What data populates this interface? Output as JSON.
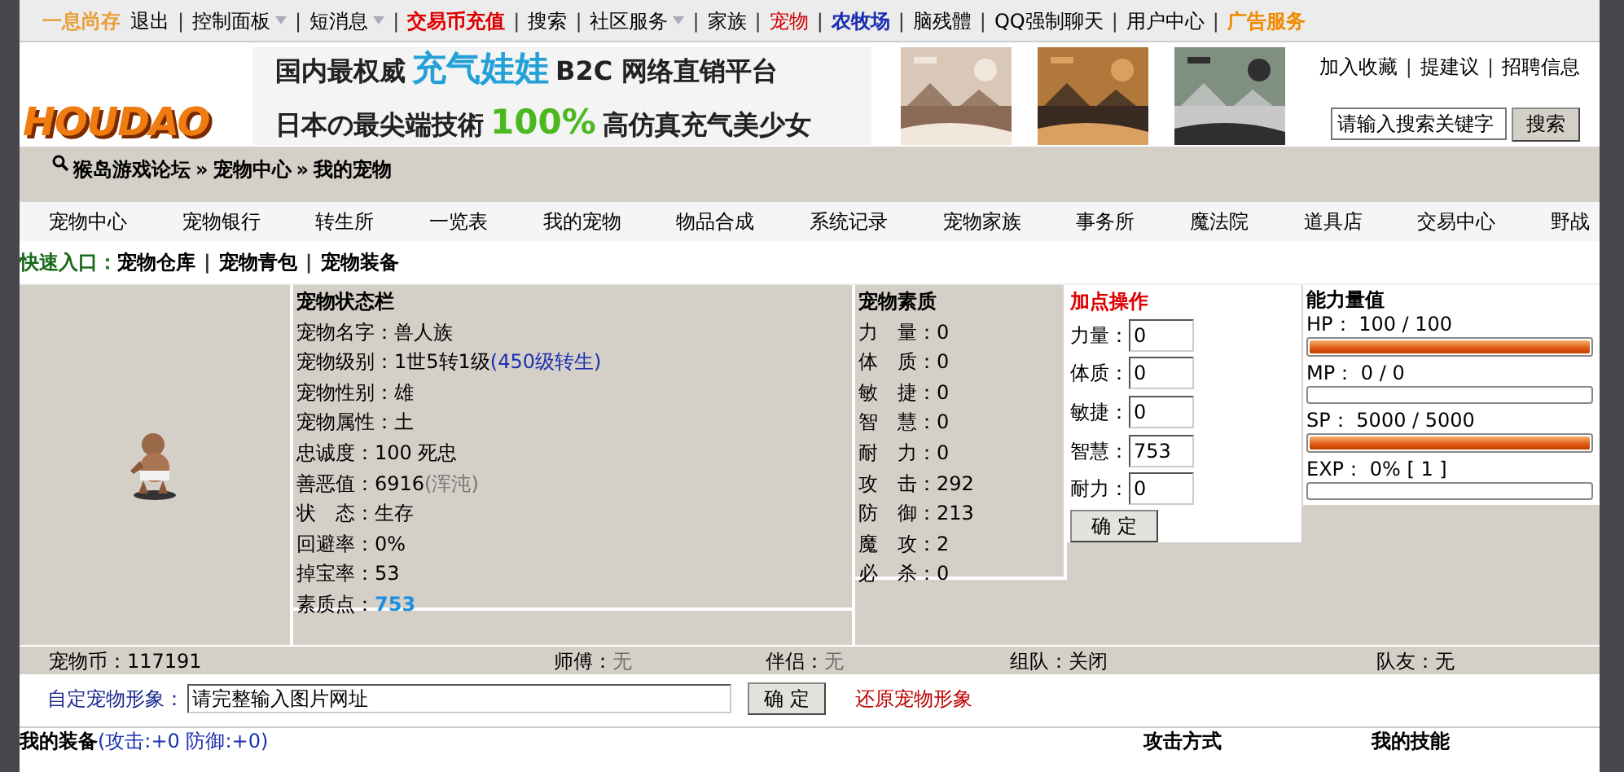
{
  "top_nav": [
    {
      "label": "一息尚存",
      "kind": "user",
      "has_menu": false
    },
    {
      "label": "退出",
      "kind": "plain",
      "has_menu": false
    },
    {
      "label": "控制面板",
      "kind": "plain",
      "has_menu": true
    },
    {
      "label": "短消息",
      "kind": "plain",
      "has_menu": true
    },
    {
      "label": "交易币充值",
      "kind": "red_bold",
      "has_menu": false
    },
    {
      "label": "搜索",
      "kind": "plain",
      "has_menu": false
    },
    {
      "label": "社区服务",
      "kind": "plain",
      "has_menu": true
    },
    {
      "label": "家族",
      "kind": "plain",
      "has_menu": false
    },
    {
      "label": "宠物",
      "kind": "red",
      "has_menu": false
    },
    {
      "label": "农牧场",
      "kind": "blue_bold",
      "has_menu": false
    },
    {
      "label": "脑残體",
      "kind": "plain",
      "has_menu": false
    },
    {
      "label": "QQ强制聊天",
      "kind": "plain",
      "has_menu": false
    },
    {
      "label": "用户中心",
      "kind": "plain",
      "has_menu": false
    },
    {
      "label": "广告服务",
      "kind": "orange_bold",
      "has_menu": false
    }
  ],
  "separator": "|",
  "logo": {
    "text": "HOUDAO"
  },
  "banner": {
    "line_1": [
      "国内最权威",
      "充气娃娃",
      "B2C 网络直销平台"
    ],
    "line_2": [
      "日本の最尖端技術",
      "100%",
      "高仿真充气美少女"
    ]
  },
  "banner_pictures": [
    {
      "kind": "picture"
    },
    {
      "kind": "picture"
    },
    {
      "kind": "picture"
    }
  ],
  "header_links": [
    "加入收藏",
    "提建议",
    "招聘信息"
  ],
  "search": {
    "value": "请输入搜索关键字",
    "button": "搜索"
  },
  "breadcrumb": [
    "猴岛游戏论坛",
    "宠物中心",
    "我的宠物"
  ],
  "breadcrumb_separator": "»",
  "menu": [
    "宠物中心",
    "宠物银行",
    "转生所",
    "一览表",
    "我的宠物",
    "物品合成",
    "系统记录",
    "宠物家族",
    "事务所",
    "魔法院",
    "道具店",
    "交易中心",
    "野战"
  ],
  "quick_entry": {
    "label": "快速入口：",
    "links": [
      "宠物仓库",
      "宠物青包",
      "宠物装备"
    ]
  },
  "status": {
    "title": "宠物状态栏",
    "rows": [
      {
        "label": "宠物名字：",
        "value": "兽人族",
        "kind": "plain"
      },
      {
        "label": "宠物级别：",
        "value": "1世5转1级",
        "link": "(450级转生)",
        "kind": "plain"
      },
      {
        "label": "宠物性别：",
        "value": "雄",
        "kind": "plain"
      },
      {
        "label": "宠物属性：",
        "value": "土",
        "kind": "plain"
      },
      {
        "label": "忠诚度：",
        "value": "100 死忠",
        "kind": "plain"
      },
      {
        "label": "善恶值：",
        "value": "6916",
        "note": "(浑沌)",
        "kind": "plain"
      },
      {
        "label": "状　态：",
        "value": "生存",
        "kind": "plain"
      },
      {
        "label": "回避率：",
        "value": "0%",
        "kind": "plain"
      },
      {
        "label": "掉宝率：",
        "value": "53",
        "kind": "plain"
      },
      {
        "label": "素质点：",
        "value": "753",
        "kind": "highlight"
      }
    ]
  },
  "attributes": {
    "title": "宠物素质",
    "rows": [
      {
        "label": "力　量：",
        "value": "0"
      },
      {
        "label": "体　质：",
        "value": "0"
      },
      {
        "label": "敏　捷：",
        "value": "0"
      },
      {
        "label": "智　慧：",
        "value": "0"
      },
      {
        "label": "耐　力：",
        "value": "0"
      },
      {
        "label": "攻　击：",
        "value": "292"
      },
      {
        "label": "防　御：",
        "value": "213"
      },
      {
        "label": "魔　攻：",
        "value": "2"
      },
      {
        "label": "必　杀：",
        "value": "0"
      }
    ]
  },
  "add_points": {
    "title": "加点操作",
    "fields": [
      {
        "label": "力量：",
        "value": "0"
      },
      {
        "label": "体质：",
        "value": "0"
      },
      {
        "label": "敏捷：",
        "value": "0"
      },
      {
        "label": "智慧：",
        "value": "753"
      },
      {
        "label": "耐力：",
        "value": "0"
      }
    ],
    "button": "确 定"
  },
  "abilities": {
    "title": "能力量值",
    "meters": [
      {
        "label": "HP： 100 / 100",
        "level": 1
      },
      {
        "label": "MP： 0 / 0",
        "level": 0
      },
      {
        "label": "SP： 5000 / 5000",
        "level": 1
      },
      {
        "label": "EXP： 0% [ 1 ]",
        "level": 0
      }
    ]
  },
  "info_bar": [
    {
      "label": "宠物币：",
      "value": "117191",
      "muted": false
    },
    {
      "label": "师傅：",
      "value": "无",
      "muted": true
    },
    {
      "label": "伴侣：",
      "value": "无",
      "muted": true
    },
    {
      "label": "组队：",
      "value": " 关闭",
      "muted": false
    },
    {
      "label": "队友：",
      "value": "无",
      "muted": false
    }
  ],
  "custom_image": {
    "label": "自定宠物形象：",
    "value": "请完整输入图片网址",
    "button": "确 定",
    "reset": "还原宠物形象"
  },
  "bottom": {
    "equipment": "我的装备",
    "equipment_bonus": "(攻击:+0 防御:+0)",
    "attack_mode": "攻击方式",
    "skills": "我的技能"
  }
}
